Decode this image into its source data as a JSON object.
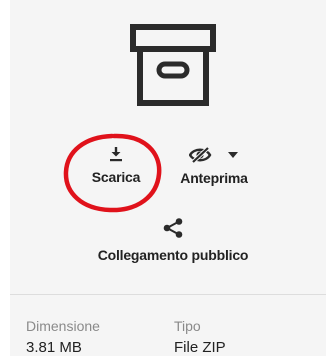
{
  "file": {
    "icon": "archive-box-icon"
  },
  "actions": {
    "download": {
      "label": "Scarica",
      "icon": "download-icon"
    },
    "preview": {
      "label": "Anteprima",
      "icon": "eye-slash-icon",
      "dropdown_icon": "caret-down-icon"
    },
    "share": {
      "label": "Collegamento pubblico",
      "icon": "share-icon"
    }
  },
  "annotation": {
    "color": "#e0121b"
  },
  "details": {
    "size": {
      "label": "Dimensione",
      "value": "3.81 MB"
    },
    "type": {
      "label": "Tipo",
      "value": "File ZIP"
    }
  }
}
